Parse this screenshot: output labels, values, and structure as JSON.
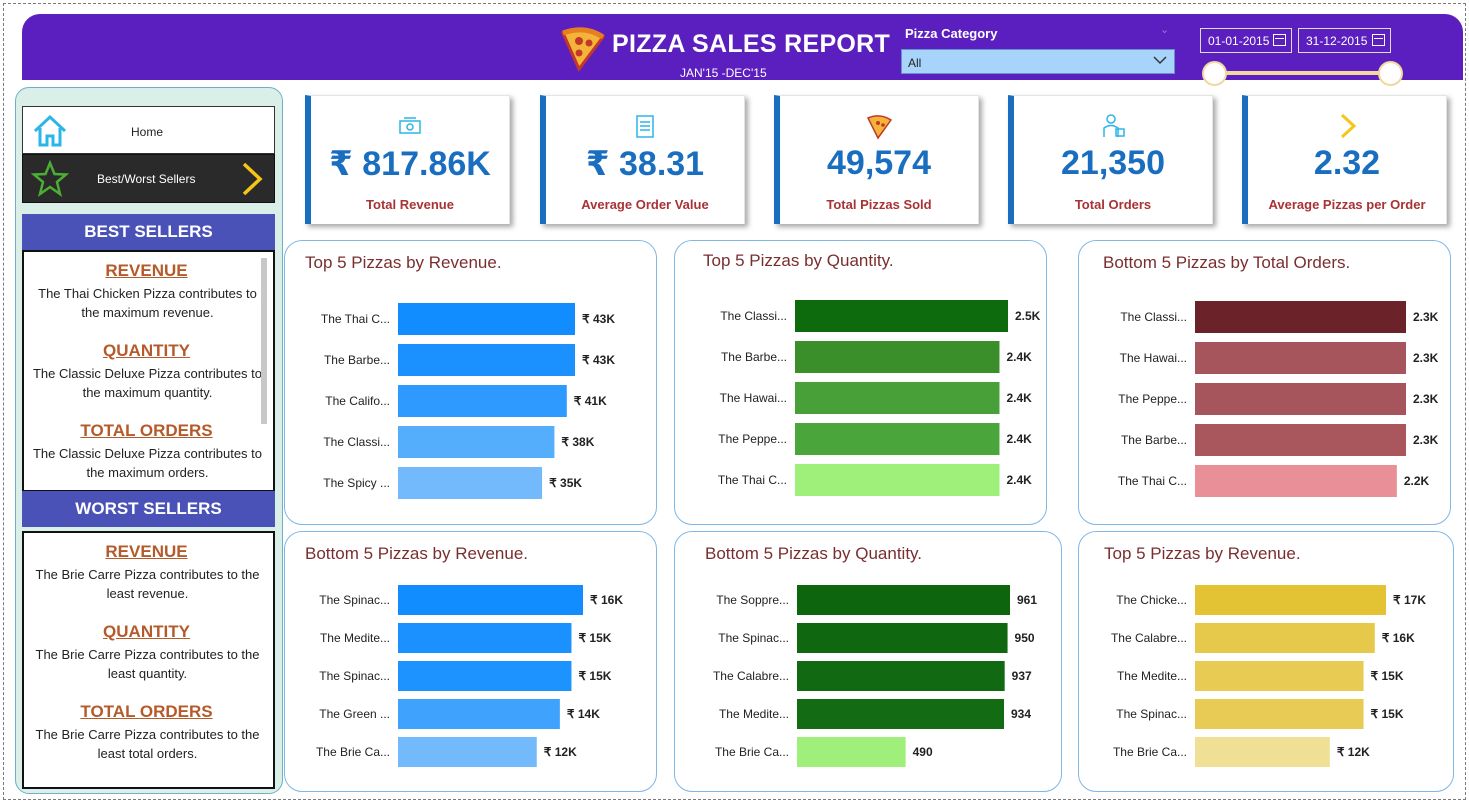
{
  "header": {
    "title": "PIZZA SALES REPORT",
    "subtitle": "JAN'15 -DEC'15",
    "category_label": "Pizza Category",
    "category_value": "All",
    "date_from": "01-01-2015",
    "date_to": "31-12-2015",
    "accent": "#5b1fbf"
  },
  "nav": {
    "home_label": "Home",
    "best_worst_label": "Best/Worst Sellers"
  },
  "best_sellers": {
    "header": "BEST SELLERS",
    "items": [
      {
        "title": "REVENUE",
        "text": "The Thai Chicken Pizza contributes to the maximum revenue."
      },
      {
        "title": "QUANTITY",
        "text": "The Classic Deluxe Pizza contributes to the maximum quantity."
      },
      {
        "title": "TOTAL ORDERS",
        "text": "The Classic Deluxe Pizza contributes to the maximum orders."
      }
    ]
  },
  "worst_sellers": {
    "header": "WORST SELLERS",
    "items": [
      {
        "title": "REVENUE",
        "text": "The Brie Carre Pizza contributes to the least revenue."
      },
      {
        "title": "QUANTITY",
        "text": "The Brie Carre Pizza contributes to the least quantity."
      },
      {
        "title": "TOTAL ORDERS",
        "text": "The Brie Carre Pizza contributes to the least total orders."
      }
    ]
  },
  "kpis": [
    {
      "value": "₹ 817.86K",
      "label": "Total Revenue",
      "icon": "money-icon"
    },
    {
      "value": "₹ 38.31",
      "label": "Average Order Value",
      "icon": "clipboard-icon"
    },
    {
      "value": "49,574",
      "label": "Total Pizzas Sold",
      "icon": "pizza-slice-icon"
    },
    {
      "value": "21,350",
      "label": "Total Orders",
      "icon": "delivery-icon"
    },
    {
      "value": "2.32",
      "label": "Average Pizzas per Order",
      "icon": "chevron-icon"
    }
  ],
  "chart_data": [
    {
      "type": "bar",
      "title": "Top 5 Pizzas by Revenue.",
      "categories": [
        "The Thai C...",
        "The Barbe...",
        "The Califo...",
        "The Classi...",
        "The Spicy ..."
      ],
      "values": [
        43,
        43,
        41,
        38,
        35
      ],
      "labels": [
        "₹ 43K",
        "₹ 43K",
        "₹ 41K",
        "₹ 38K",
        "₹ 35K"
      ],
      "colors": [
        "#118dff",
        "#1a91ff",
        "#2e99ff",
        "#55aefc",
        "#72bafc"
      ],
      "xlim": [
        0,
        43
      ]
    },
    {
      "type": "bar",
      "title": "Top 5 Pizzas by Quantity.",
      "categories": [
        "The Classi...",
        "The Barbe...",
        "The Hawai...",
        "The Peppe...",
        "The Thai C..."
      ],
      "values": [
        2.5,
        2.4,
        2.4,
        2.4,
        2.4
      ],
      "labels": [
        "2.5K",
        "2.4K",
        "2.4K",
        "2.4K",
        "2.4K"
      ],
      "colors": [
        "#0d6a0d",
        "#3b8f2a",
        "#48a038",
        "#4aa53a",
        "#9ef07a"
      ],
      "xlim": [
        0,
        2.5
      ]
    },
    {
      "type": "bar",
      "title": "Bottom 5 Pizzas by Total Orders.",
      "categories": [
        "The Classi...",
        "The Hawai...",
        "The Peppe...",
        "The Barbe...",
        "The Thai C..."
      ],
      "values": [
        2.3,
        2.3,
        2.3,
        2.3,
        2.2
      ],
      "labels": [
        "2.3K",
        "2.3K",
        "2.3K",
        "2.3K",
        "2.2K"
      ],
      "colors": [
        "#6b2228",
        "#a7555c",
        "#a7555c",
        "#a9565d",
        "#e88f97"
      ],
      "xlim": [
        0,
        2.3
      ]
    },
    {
      "type": "bar",
      "title": "Bottom 5 Pizzas by Revenue.",
      "categories": [
        "The Spinac...",
        "The Medite...",
        "The Spinac...",
        "The Green ...",
        "The Brie Ca..."
      ],
      "values": [
        16,
        15,
        15,
        14,
        12
      ],
      "labels": [
        "₹ 16K",
        "₹ 15K",
        "₹ 15K",
        "₹ 14K",
        "₹ 12K"
      ],
      "colors": [
        "#118dff",
        "#1a91ff",
        "#1d93ff",
        "#3fa3fd",
        "#72bafc"
      ],
      "xlim": [
        0,
        16
      ]
    },
    {
      "type": "bar",
      "title": "Bottom 5 Pizzas by Quantity.",
      "categories": [
        "The Soppre...",
        "The Spinac...",
        "The Calabre...",
        "The Medite...",
        "The Brie Ca..."
      ],
      "values": [
        961,
        950,
        937,
        934,
        490
      ],
      "labels": [
        "961",
        "950",
        "937",
        "934",
        "490"
      ],
      "colors": [
        "#0d650d",
        "#0f680f",
        "#116a11",
        "#136c13",
        "#9ef07a"
      ],
      "xlim": [
        0,
        961
      ]
    },
    {
      "type": "bar",
      "title": "Top 5 Pizzas by Revenue.",
      "categories": [
        "The Chicke...",
        "The Calabre...",
        "The Medite...",
        "The Spinac...",
        "The Brie Ca..."
      ],
      "values": [
        17,
        16,
        15,
        15,
        12
      ],
      "labels": [
        "₹ 17K",
        "₹ 16K",
        "₹ 15K",
        "₹ 15K",
        "₹ 12K"
      ],
      "colors": [
        "#e3c333",
        "#e6c84a",
        "#e8cb52",
        "#e8cb55",
        "#efe096"
      ],
      "xlim": [
        0,
        17
      ]
    }
  ]
}
